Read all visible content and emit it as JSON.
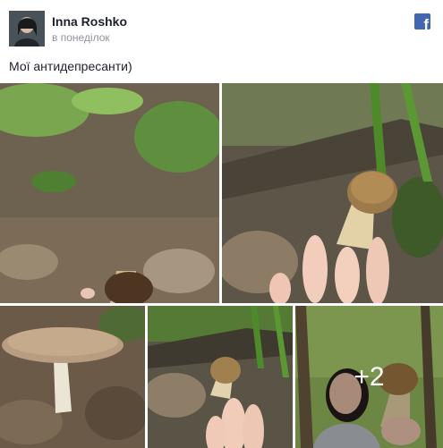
{
  "post": {
    "author_name": "Inna Roshko",
    "timestamp": "в понеділок",
    "text": "Мої антидепресанти)",
    "more_photos_label": "+2"
  },
  "photos": [
    {
      "subject": "mushroom-in-leaves"
    },
    {
      "subject": "mushroom-near-hand"
    },
    {
      "subject": "large-mushroom-cap"
    },
    {
      "subject": "small-mushroom-near-hand"
    },
    {
      "subject": "woman-holding-mushroom"
    }
  ],
  "icons": {
    "facebook_logo": "facebook-icon"
  },
  "colors": {
    "facebook_blue": "#4267b2",
    "name_text": "#1d2129",
    "meta_text": "#90949c"
  }
}
